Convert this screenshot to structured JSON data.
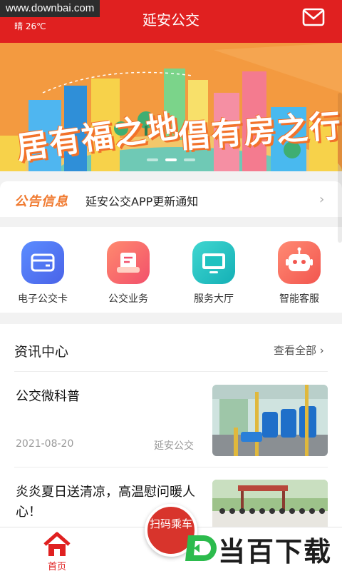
{
  "watermark_url": "www.downbai.com",
  "weather": "晴 26℃",
  "app_title": "延安公交",
  "banner": {
    "slogan_1": "居有福之地",
    "slogan_2": "倡有房之行",
    "slide_count": 3,
    "active_slide": 1
  },
  "notice": {
    "badge": "公告信息",
    "text": "延安公交APP更新通知",
    "arrow": "›"
  },
  "shortcuts": [
    {
      "label": "电子公交卡",
      "icon": "bus-card-icon"
    },
    {
      "label": "公交业务",
      "icon": "bus-business-icon"
    },
    {
      "label": "服务大厅",
      "icon": "monitor-icon"
    },
    {
      "label": "智能客服",
      "icon": "robot-icon"
    }
  ],
  "news": {
    "title": "资讯中心",
    "view_all": "查看全部 ›",
    "articles": [
      {
        "title": "公交微科普",
        "date": "2021-08-20",
        "source": "延安公交"
      },
      {
        "title": "炎炎夏日送清凉，高温慰问暖人心！"
      }
    ]
  },
  "tabbar": {
    "home_label": "首页",
    "scan_label": "扫码乘车"
  },
  "brand_watermark": "当百下载",
  "colors": {
    "primary_red": "#e02020",
    "notice_orange": "#f07a30"
  }
}
